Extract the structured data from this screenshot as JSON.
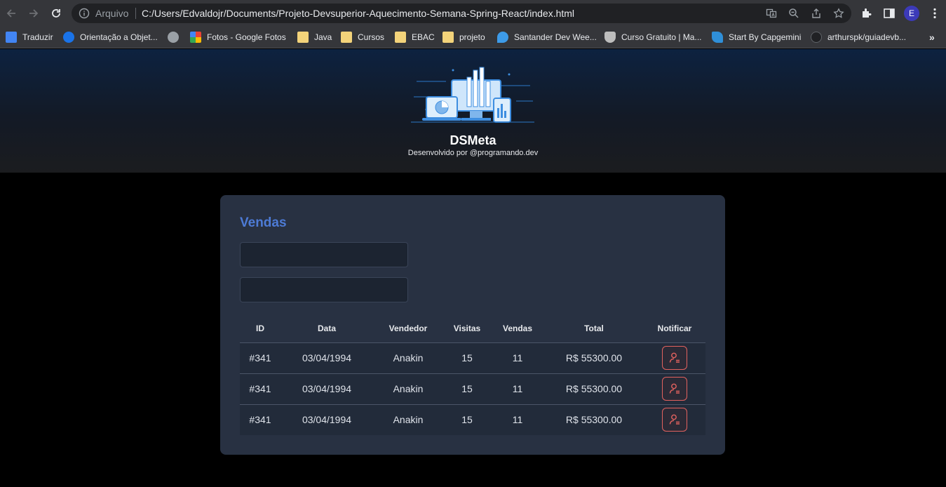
{
  "browser": {
    "address_scheme": "Arquivo",
    "address_url": "C:/Users/Edvaldojr/Documents/Projeto-Devsuperior-Aquecimento-Semana-Spring-React/index.html",
    "profile_initial": "E",
    "bookmarks": [
      {
        "label": "Traduzir",
        "icon": "google-translate-icon",
        "color": "#4285f4"
      },
      {
        "label": "Orientação a Objet...",
        "icon": "c-logo-icon",
        "color": "#1a73e8"
      },
      {
        "label": "",
        "icon": "globe-icon",
        "color": "#9aa0a6"
      },
      {
        "label": "Fotos - Google Fotos",
        "icon": "google-photos-icon",
        "color": "#fbbc04"
      },
      {
        "label": "Java",
        "icon": "folder-icon",
        "color": "#f3d37a"
      },
      {
        "label": "Cursos",
        "icon": "folder-icon",
        "color": "#f3d37a"
      },
      {
        "label": "EBAC",
        "icon": "folder-icon",
        "color": "#f3d37a"
      },
      {
        "label": "projeto",
        "icon": "folder-icon",
        "color": "#f3d37a"
      },
      {
        "label": "Santander Dev Wee...",
        "icon": "drop-icon",
        "color": "#3d9be9"
      },
      {
        "label": "Curso Gratuito | Ma...",
        "icon": "crest-icon",
        "color": "#bdbdbd"
      },
      {
        "label": "Start By Capgemini",
        "icon": "capgemini-icon",
        "color": "#2f8fd8"
      },
      {
        "label": "arthurspk/guiadevb...",
        "icon": "github-icon",
        "color": "#202124"
      }
    ]
  },
  "header": {
    "brand": "DSMeta",
    "byline": "Desenvolvido por @programando.dev"
  },
  "sales": {
    "title": "Vendas",
    "columns": [
      "ID",
      "Data",
      "Vendedor",
      "Visitas",
      "Vendas",
      "Total",
      "Notificar"
    ],
    "rows": [
      {
        "id": "#341",
        "date": "03/04/1994",
        "seller": "Anakin",
        "visits": "15",
        "deals": "11",
        "total": "R$ 55300.00"
      },
      {
        "id": "#341",
        "date": "03/04/1994",
        "seller": "Anakin",
        "visits": "15",
        "deals": "11",
        "total": "R$ 55300.00"
      },
      {
        "id": "#341",
        "date": "03/04/1994",
        "seller": "Anakin",
        "visits": "15",
        "deals": "11",
        "total": "R$ 55300.00"
      }
    ]
  },
  "colors": {
    "accent": "#4d7bd6",
    "notify": "#e3625f",
    "card": "#283142"
  }
}
